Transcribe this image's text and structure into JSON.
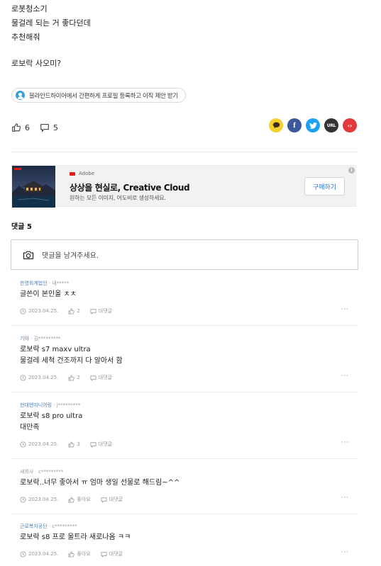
{
  "post": {
    "lines": [
      "로봇청소기",
      "물걸레 되는 거 좋다던데",
      "추천해줘",
      "로보락 사오미?"
    ]
  },
  "promo": {
    "icon": "user-icon",
    "text": "블라인드하이어에서 간편하게 프로필 등록하고 이직 제안 받기"
  },
  "reactions": {
    "likes": "6",
    "comments": "5"
  },
  "share": {
    "buttons": [
      {
        "name": "kakao",
        "icon": "kakao-icon",
        "color": "#f5d130"
      },
      {
        "name": "facebook",
        "icon": "facebook-icon",
        "color": "#3b5998",
        "glyph": "f"
      },
      {
        "name": "twitter",
        "icon": "twitter-icon",
        "color": "#1da1f2"
      },
      {
        "name": "url",
        "icon": "url-icon",
        "color": "#333333",
        "glyph": "URL"
      },
      {
        "name": "embed",
        "icon": "embed-icon",
        "color": "#e03a3a",
        "glyph": "‹›"
      }
    ]
  },
  "ad": {
    "brand": "Adobe",
    "title": "상상을 현실로, Creative Cloud",
    "description": "원하는 모든 이미지, 어도비로 생성하세요.",
    "cta": "구매하기",
    "info": "i"
  },
  "comments_section": {
    "heading": "댓글 5",
    "input_placeholder": "댓글을 남겨주세요.",
    "reply_label": "대댓글",
    "comments": [
      {
        "company": "한영회계법인",
        "author": "· 내*****",
        "lines": [
          "글쓴이 본인올 ㅊㅊ"
        ],
        "date": "2023.04.25.",
        "likes": "2"
      },
      {
        "company": "기아",
        "author": "· 김*********",
        "lines": [
          "로보락 s7 maxv ultra",
          "물걸레 세척 건조까지 다 알아서 함"
        ],
        "date": "2023.04.25.",
        "likes": "2"
      },
      {
        "company": "현대엔지니어링",
        "author": "· j*********",
        "lines": [
          "로보락 s8 pro ultra",
          "대만족"
        ],
        "date": "2023.04.25.",
        "likes": "3"
      },
      {
        "company": "새회사",
        "author": "· c*********",
        "lines": [
          "로보락..너무 좋아서 ㅠ 엄마 생일 선물로 해드림~^^"
        ],
        "date": "2023.04.25.",
        "likes": "좋아요"
      },
      {
        "company": "근로복지공단",
        "author": "· c*********",
        "lines": [
          "로보락 s8 프로 울트라 새로나옴 ㅋㅋ"
        ],
        "date": "2023.04.25.",
        "likes": "좋아요"
      }
    ]
  }
}
